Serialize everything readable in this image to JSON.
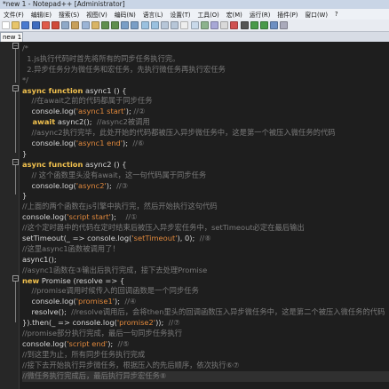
{
  "window": {
    "title": "*new 1 - Notepad++ [Administrator]"
  },
  "menu": [
    "文件(F)",
    "编辑(E)",
    "搜索(S)",
    "视图(V)",
    "编码(N)",
    "语言(L)",
    "设置(T)",
    "工具(O)",
    "宏(M)",
    "运行(R)",
    "插件(P)",
    "窗口(W)",
    "?"
  ],
  "tab": {
    "label": "new 1"
  },
  "code_lines": [
    [
      [
        "c",
        "/*"
      ]
    ],
    [
      [
        "c",
        "  1.js执行代码时首先将所有的同步任务执行完。"
      ]
    ],
    [
      [
        "c",
        "  2.异步任务分为微任务和宏任务，先执行微任务再执行宏任务"
      ]
    ],
    [
      [
        "c",
        "*/"
      ]
    ],
    [
      [
        "k",
        "async function"
      ],
      [
        "p",
        " async1 () {"
      ]
    ],
    [
      [
        "c",
        "    //在await之前的代码都属于同步任务"
      ]
    ],
    [
      [
        "p",
        "    console.log("
      ],
      [
        "s",
        "'async1 start'"
      ],
      [
        "p",
        "); "
      ],
      [
        "c",
        "//②"
      ]
    ],
    [
      [
        "k",
        "    await"
      ],
      [
        "p",
        " async2();  "
      ],
      [
        "c",
        "//async2被调用"
      ]
    ],
    [
      [
        "c",
        "    //async2执行完毕，此处开始的代码都被压入异步微任务中，这是第一个被压入微任务的代码"
      ]
    ],
    [
      [
        "p",
        "    console.log("
      ],
      [
        "s",
        "'async1 end'"
      ],
      [
        "p",
        ");  "
      ],
      [
        "c",
        "//⑥"
      ]
    ],
    [
      [
        "p",
        "}"
      ]
    ],
    [
      [
        "k",
        "async function"
      ],
      [
        "p",
        " async2 () {"
      ]
    ],
    [
      [
        "c",
        "    // 这个函数里头没有await，这一句代码属于同步任务"
      ]
    ],
    [
      [
        "p",
        "    console.log("
      ],
      [
        "s",
        "'async2'"
      ],
      [
        "p",
        ");  "
      ],
      [
        "c",
        "//③"
      ]
    ],
    [
      [
        "p",
        "}"
      ]
    ],
    [
      [
        "c",
        "//上面的两个函数在js引擎中执行完，然后开始执行这句代码"
      ]
    ],
    [
      [
        "p",
        "console.log("
      ],
      [
        "s",
        "'script start'"
      ],
      [
        "p",
        ");    "
      ],
      [
        "c",
        "//①"
      ]
    ],
    [
      [
        "c",
        "//这个定时器中的代码在定时结束后被压入异步宏任务中，setTimeout必定在最后输出"
      ]
    ],
    [
      [
        "p",
        "setTimeout(_ => console.log("
      ],
      [
        "s",
        "'setTimeout'"
      ],
      [
        "p",
        "), 0);  "
      ],
      [
        "c",
        "//⑧"
      ]
    ],
    [
      [
        "c",
        "//这里async1函数被调用了！"
      ]
    ],
    [
      [
        "p",
        "async1();"
      ]
    ],
    [
      [
        "c",
        "//async1函数在③输出后执行完成，接下去处理Promise"
      ]
    ],
    [
      [
        "k",
        "new"
      ],
      [
        "p",
        " Promise (resolve => {"
      ]
    ],
    [
      [
        "c",
        "    //promise调用时候传入的回调函数是一个同步任务"
      ]
    ],
    [
      [
        "p",
        "    console.log("
      ],
      [
        "s",
        "'promise1'"
      ],
      [
        "p",
        ");  "
      ],
      [
        "c",
        "//④"
      ]
    ],
    [
      [
        "p",
        "    resolve();  "
      ],
      [
        "c",
        "//resolve调用后，会将then里头的回调函数压入异步微任务中，这是第二个被压入微任务的代码"
      ]
    ],
    [
      [
        "p",
        "}).then(_ => console.log("
      ],
      [
        "s",
        "'promise2'"
      ],
      [
        "p",
        "));  "
      ],
      [
        "c",
        "//⑦"
      ]
    ],
    [
      [
        "c",
        "//promise部分执行完成，最后一句同步任务执行"
      ]
    ],
    [
      [
        "p",
        "console.log("
      ],
      [
        "s",
        "'script end'"
      ],
      [
        "p",
        ");  "
      ],
      [
        "c",
        "//⑤"
      ]
    ],
    [
      [
        "c",
        "//到这里为止，所有同步任务执行完成"
      ]
    ],
    [
      [
        "c",
        "//接下去开始执行异步微任务，根据压入的先后顺序，依次执行⑥⑦"
      ]
    ],
    [
      [
        "c",
        "//微任务执行完成后，最后执行异步宏任务⑧"
      ]
    ]
  ]
}
